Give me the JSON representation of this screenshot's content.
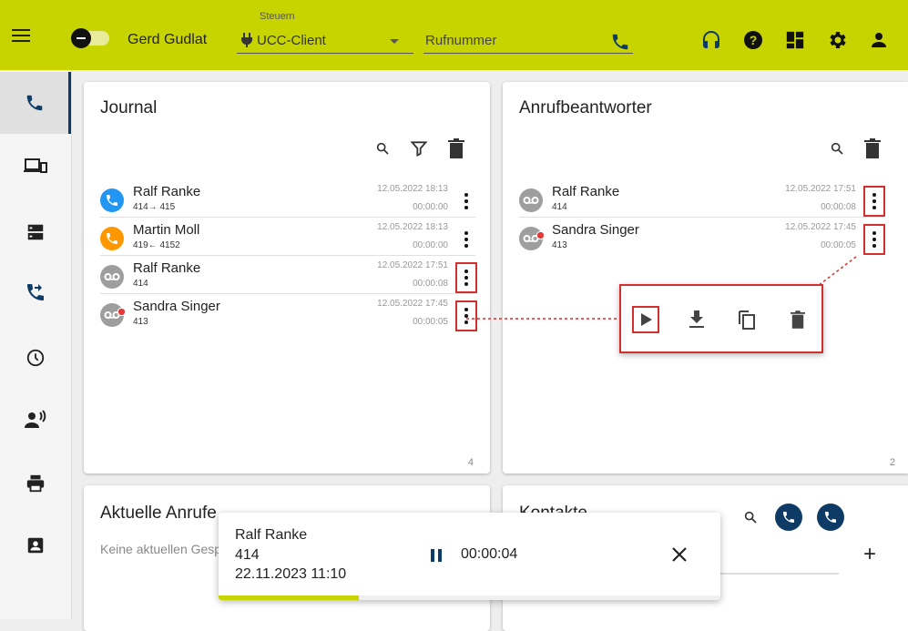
{
  "topbar": {
    "user_name": "Gerd Gudlat",
    "control_label": "Steuern",
    "control_value": "UCC-Client",
    "phone_placeholder": "Rufnummer",
    "icons": [
      "headset-icon",
      "help-icon",
      "dashboard-icon",
      "settings-icon",
      "person-icon"
    ]
  },
  "sidebar": {
    "items": [
      {
        "name": "phone",
        "active": true
      },
      {
        "name": "devices"
      },
      {
        "name": "server"
      },
      {
        "name": "call-forward"
      },
      {
        "name": "history"
      },
      {
        "name": "presence"
      },
      {
        "name": "print"
      },
      {
        "name": "contact-card"
      }
    ]
  },
  "journal": {
    "title": "Journal",
    "count": "4",
    "rows": [
      {
        "name": "Ralf Ranke",
        "number": "414→ 415",
        "date": "12.05.2022 18:13",
        "duration": "00:00:00",
        "type": "outgoing",
        "color": "#2196f3"
      },
      {
        "name": "Martin Moll",
        "number": "419← 4152",
        "date": "12.05.2022 18:13",
        "duration": "00:00:00",
        "type": "missed",
        "color": "#ff9800"
      },
      {
        "name": "Ralf Ranke",
        "number": "414",
        "date": "12.05.2022 17:51",
        "duration": "00:00:08",
        "type": "voicemail",
        "color": "#9e9e9e"
      },
      {
        "name": "Sandra Singer",
        "number": "413",
        "date": "12.05.2022 17:45",
        "duration": "00:00:05",
        "type": "voicemail-new",
        "color": "#9e9e9e"
      }
    ]
  },
  "answering_machine": {
    "title": "Anrufbeantworter",
    "count": "2",
    "rows": [
      {
        "name": "Ralf Ranke",
        "number": "414",
        "date": "12.05.2022 17:51",
        "duration": "00:00:08"
      },
      {
        "name": "Sandra Singer",
        "number": "413",
        "date": "12.05.2022 17:45",
        "duration": "00:00:05"
      }
    ]
  },
  "current_calls": {
    "title": "Aktuelle Anrufe",
    "empty_text": "Keine aktuellen Gespräche"
  },
  "contacts": {
    "title": "Kontakte",
    "add_label": "+"
  },
  "player": {
    "name": "Ralf Ranke",
    "number": "414",
    "datetime": "22.11.2023 11:10",
    "elapsed": "00:00:04",
    "progress_fraction": 0.28
  },
  "colors": {
    "accent": "#c8d400",
    "dark_blue": "#0d3b66",
    "highlight": "#d32f2f"
  }
}
